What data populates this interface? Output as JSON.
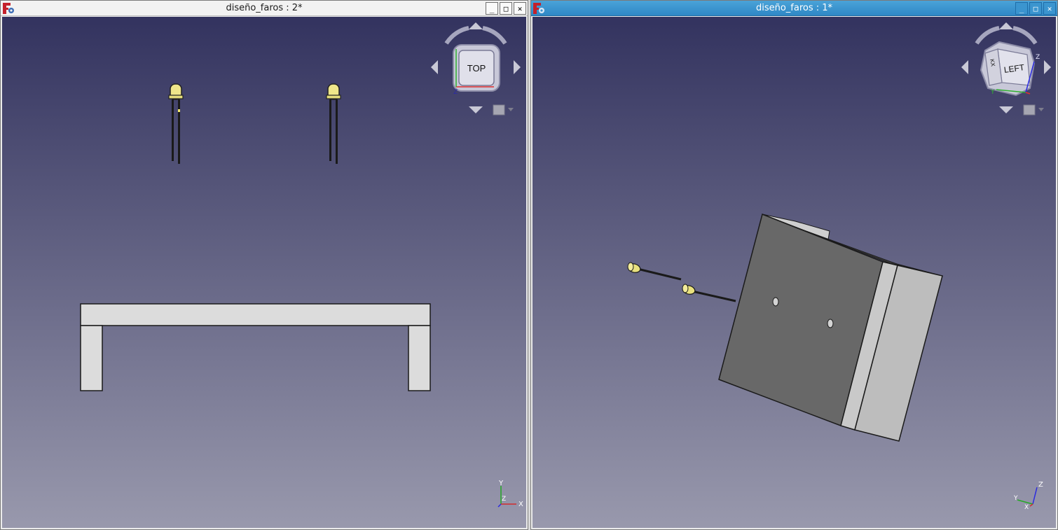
{
  "windows": [
    {
      "title": "diseño_faros : 2*",
      "view": {
        "navcube_face": "TOP",
        "axis_labels": [
          "Y",
          "Z",
          "X"
        ]
      }
    },
    {
      "title": "diseño_faros : 1*",
      "view": {
        "navcube_face": "LEFT",
        "navcube_side_face": "KX",
        "axis_labels": [
          "Z",
          "Y",
          "X"
        ]
      }
    }
  ],
  "window_buttons": {
    "minimize": "_",
    "maximize": "□",
    "close": "✕"
  },
  "icons": {
    "app": "freecad-icon",
    "navigate": "arrow-icon",
    "menu": "cube-menu-icon"
  },
  "colors": {
    "viewport_top": "#33335f",
    "viewport_bottom": "#9999ad",
    "active_title": "#3a94cf",
    "led_yellow": "#efe68a",
    "box_dark": "#686868",
    "box_light": "#c4c4c4"
  }
}
